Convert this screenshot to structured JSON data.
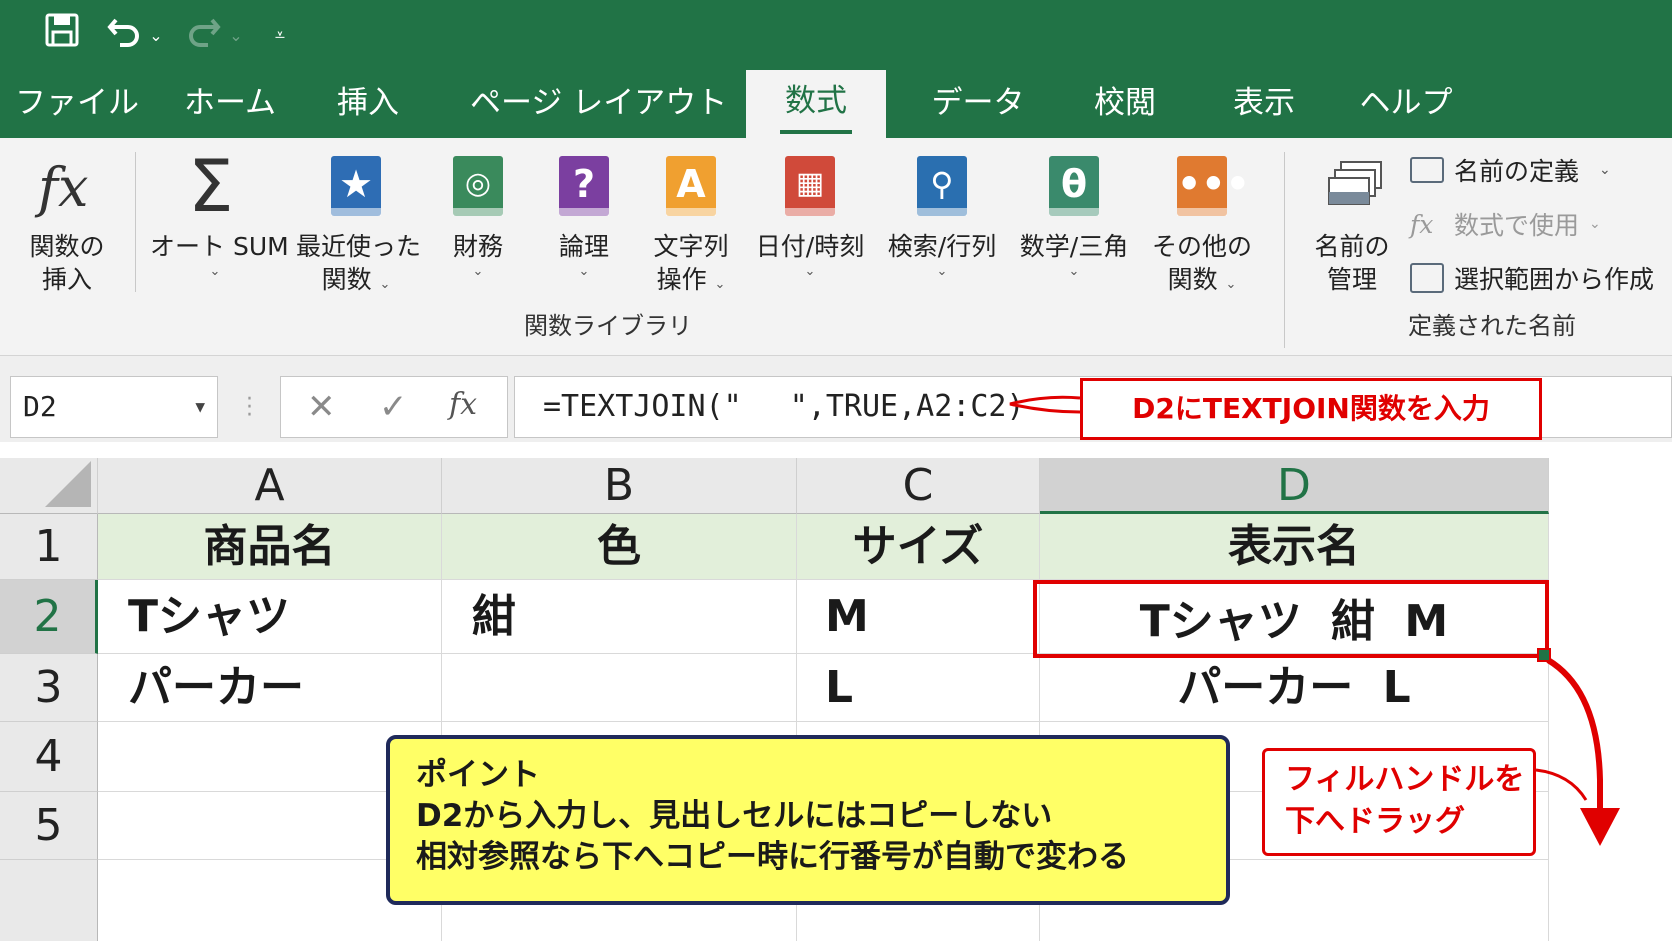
{
  "qat": {
    "save_icon": "save-icon",
    "undo_icon": "undo-icon",
    "redo_icon": "redo-icon",
    "customize_icon": "customize-qat-icon"
  },
  "tabs": [
    "ファイル",
    "ホーム",
    "挿入",
    "ページ レイアウト",
    "数式",
    "データ",
    "校閲",
    "表示",
    "ヘルプ"
  ],
  "active_tab": "数式",
  "ribbon": {
    "insert_function": {
      "line1": "関数の",
      "line2": "挿入"
    },
    "autosum": "オート SUM",
    "recent": {
      "line1": "最近使った",
      "line2": "関数"
    },
    "financial": "財務",
    "logical": "論理",
    "text": {
      "line1": "文字列",
      "line2": "操作"
    },
    "datetime": "日付/時刻",
    "lookup": "検索/行列",
    "math": "数学/三角",
    "more": {
      "line1": "その他の",
      "line2": "関数"
    },
    "group_library": "関数ライブラリ",
    "name_manager": {
      "line1": "名前の",
      "line2": "管理"
    },
    "define_name": "名前の定義",
    "use_in_formula": "数式で使用",
    "create_from_selection": "選択範囲から作成",
    "group_names": "定義された名前",
    "colors": {
      "financial": "#3a8a5c",
      "logical": "#7b3fa0",
      "text": "#f0a030",
      "datetime": "#d04a3a",
      "lookup": "#2a6fb0",
      "math": "#3a8a6c",
      "more": "#e07a30",
      "recent": "#2e6db4"
    }
  },
  "formula_bar": {
    "name_box": "D2",
    "cancel_glyph": "✕",
    "enter_glyph": "✓",
    "fx_glyph": "fx",
    "formula": "=TEXTJOIN(\"　 \",TRUE,A2:C2)"
  },
  "sheet": {
    "columns": [
      "A",
      "B",
      "C",
      "D"
    ],
    "rows": [
      "1",
      "2",
      "3",
      "4",
      "5"
    ],
    "header_row": [
      "商品名",
      "色",
      "サイズ",
      "表示名"
    ],
    "data": [
      [
        "Tシャツ",
        "紺",
        "M",
        "Tシャツ 紺 M"
      ],
      [
        "パーカー",
        "",
        "L",
        "パーカー L"
      ]
    ],
    "selected_cell": "D2"
  },
  "annotations": {
    "formula_note": "D2にTEXTJOIN関数を入力",
    "point_title": "ポイント",
    "point_line1": "D2から入力し、見出しセルにはコピーしない",
    "point_line2": "相対参照なら下へコピー時に行番号が自動で変わる",
    "fill_line1": "フィルハンドルを",
    "fill_line2": "下へドラッグ",
    "accent_color": "#e00000",
    "excel_green": "#217346"
  }
}
